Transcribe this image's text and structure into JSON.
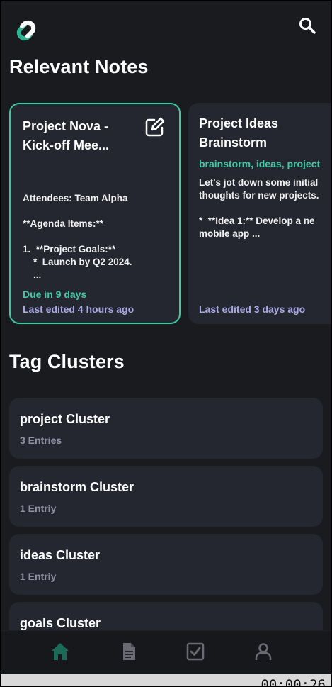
{
  "header": {
    "logo_icon": "link-icon",
    "search_icon": "search-icon"
  },
  "sections": {
    "relevant_notes": "Relevant Notes",
    "tag_clusters": "Tag Clusters"
  },
  "notes": [
    {
      "title_line1": "Project Nova -",
      "title_line2": "Kick-off Mee...",
      "body": "Attendees: Team Alpha\n\n**Agenda Items:**\n\n1.  **Project Goals:**\n    *  Launch by Q2 2024.\n    ...",
      "due": "Due in 9 days",
      "edited": "Last edited 4 hours ago"
    },
    {
      "title_line1": "Project Ideas",
      "title_line2": "Brainstorm",
      "tags": "brainstorm, ideas, project",
      "body": "Let's jot down some initial\nthoughts for new projects.\n\n*  **Idea 1:** Develop a ne\nmobile app ...",
      "edited": "Last edited 3 days ago"
    }
  ],
  "clusters": [
    {
      "name": "project Cluster",
      "count": "3 Entries"
    },
    {
      "name": "brainstorm Cluster",
      "count": "1 Entriy"
    },
    {
      "name": "ideas Cluster",
      "count": "1 Entriy"
    },
    {
      "name": "goals Cluster",
      "count": ""
    }
  ],
  "nav": [
    "home-icon",
    "document-icon",
    "checkbox-icon",
    "profile-icon"
  ],
  "colors": {
    "background": "#1a1b1f",
    "card": "#252730",
    "accent": "#3ec9a6",
    "edited": "#a9a9e6",
    "muted": "#8f90a6"
  },
  "timer": "00:00:26"
}
